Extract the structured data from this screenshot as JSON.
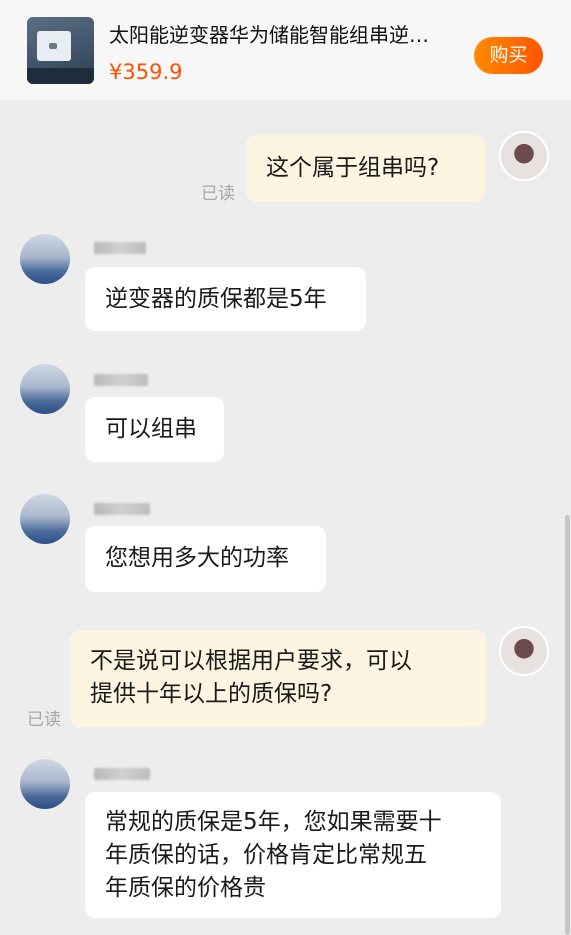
{
  "product": {
    "title": "太阳能逆变器华为储能智能组串逆…",
    "price": "¥359.9",
    "buy_label": "购买"
  },
  "messages": [
    {
      "side": "right",
      "text": "这个属于组串吗?",
      "status": "已读"
    },
    {
      "side": "left",
      "text": "逆变器的质保都是5年"
    },
    {
      "side": "left",
      "text": "可以组串"
    },
    {
      "side": "left",
      "text": "您想用多大的功率"
    },
    {
      "side": "right",
      "lines": [
        "不是说可以根据用户要求，可以",
        "提供十年以上的质保吗?"
      ],
      "status": "已读"
    },
    {
      "side": "left",
      "lines": [
        "常规的质保是5年，您如果需要十",
        "年质保的话，价格肯定比常规五",
        "年质保的价格贵"
      ]
    }
  ],
  "colors": {
    "background": "#ededed",
    "price": "#ff5000",
    "buy_button": "#ff6a00",
    "own_bubble": "#fdf5e2",
    "other_bubble": "#ffffff",
    "read_status": "#a7a7a7"
  }
}
